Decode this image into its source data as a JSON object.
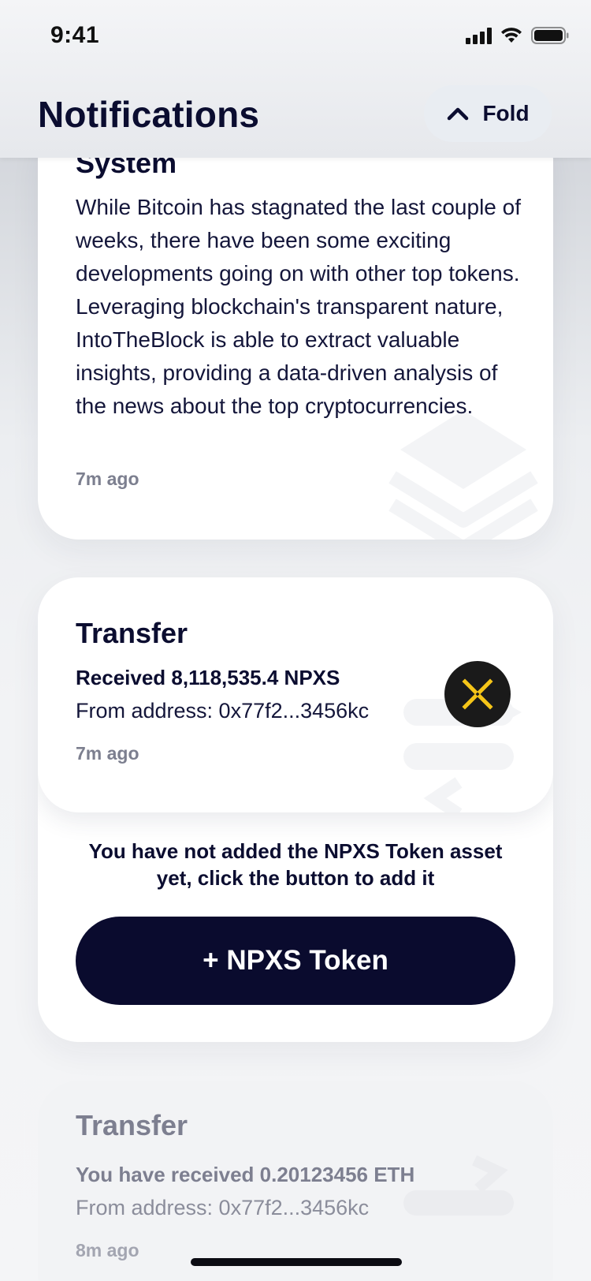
{
  "status_bar": {
    "time": "9:41",
    "icons": [
      "cellular-signal-icon",
      "wifi-icon",
      "battery-icon"
    ]
  },
  "header": {
    "title": "Notifications",
    "fold_button": {
      "label": "Fold",
      "icon": "chevron-up-icon"
    }
  },
  "notifications": [
    {
      "title": "System",
      "body": "While Bitcoin has stagnated the last couple of weeks, there have been some exciting developments going on with other top tokens. Leveraging blockchain's transparent nature, IntoTheBlock is able to extract valuable insights, providing a data-driven analysis of the news about the top cryptocurrencies.",
      "time": "7m ago",
      "watermark_icon": "layers-icon"
    },
    {
      "title": "Transfer",
      "amount": "Received 8,118,535.4 NPXS",
      "from": "From address: 0x77f2...3456kc",
      "time": "7m ago",
      "token_icon": "npxs-token-icon",
      "watermark_icon": "transfer-arrows-icon",
      "notice": "You have not added the NPXS Token asset yet, click the button to add it",
      "action_label": "+ NPXS Token"
    },
    {
      "title": "Transfer",
      "amount": "You have received 0.20123456 ETH",
      "from": "From address: 0x77f2...3456kc",
      "time": "8m ago",
      "watermark_icon": "transfer-arrows-icon"
    }
  ],
  "colors": {
    "navy": "#0b0d30",
    "button_bg": "#0a0b2e",
    "muted": "#7c7f8f",
    "npxs_yellow": "#f5c518",
    "card_bg": "#ffffff"
  }
}
